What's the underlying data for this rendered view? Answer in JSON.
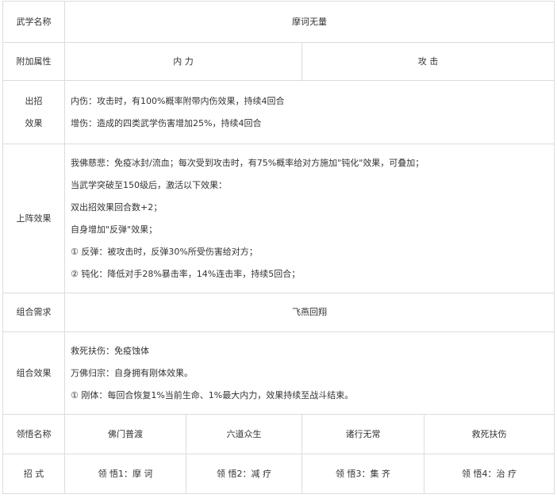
{
  "rows": {
    "name": {
      "label": "武学名称",
      "value": "摩诃无量"
    },
    "attrs": {
      "label": "附加属性",
      "values": [
        "内 力",
        "攻 击"
      ]
    },
    "effect": {
      "label_line1": "出招",
      "label_line2": "效果",
      "lines": [
        "内伤：攻击时，有100%概率附带内伤效果，持续4回合",
        "增伤：造成的四类武学伤害增加25%，持续4回合"
      ]
    },
    "battle": {
      "label": "上阵效果",
      "lines": [
        "我佛慈悲：免疫冰封/流血；每次受到攻击时，有75%概率给对方施加\"钝化\"效果，可叠加；",
        "当武学突破至150级后，激活以下效果：",
        "双出招效果回合数+2；",
        "自身增加\"反弹\"效果；",
        "① 反弹：被攻击时，反弹30%所受伤害给对方；",
        "② 钝化：降低对手28%暴击率，14%连击率，持续5回合；"
      ]
    },
    "combo_req": {
      "label": "组合需求",
      "value": "飞燕回翔"
    },
    "combo_effect": {
      "label": "组合效果",
      "lines": [
        "救死扶伤：免疫蚀体",
        "万佛归宗：自身拥有刚体效果。",
        "① 刚体：每回合恢复1%当前生命、1%最大内力，效果持续至战斗结束。"
      ]
    },
    "comprehend": {
      "label": "领悟名称",
      "values": [
        "佛门普渡",
        "六道众生",
        "诸行无常",
        "救死扶伤"
      ]
    },
    "moves": {
      "label": "招 式",
      "values": [
        "领 悟1：摩 诃",
        "领 悟2：减 疗",
        "领 悟3：集 齐",
        "领 悟4：治 疗"
      ]
    }
  }
}
